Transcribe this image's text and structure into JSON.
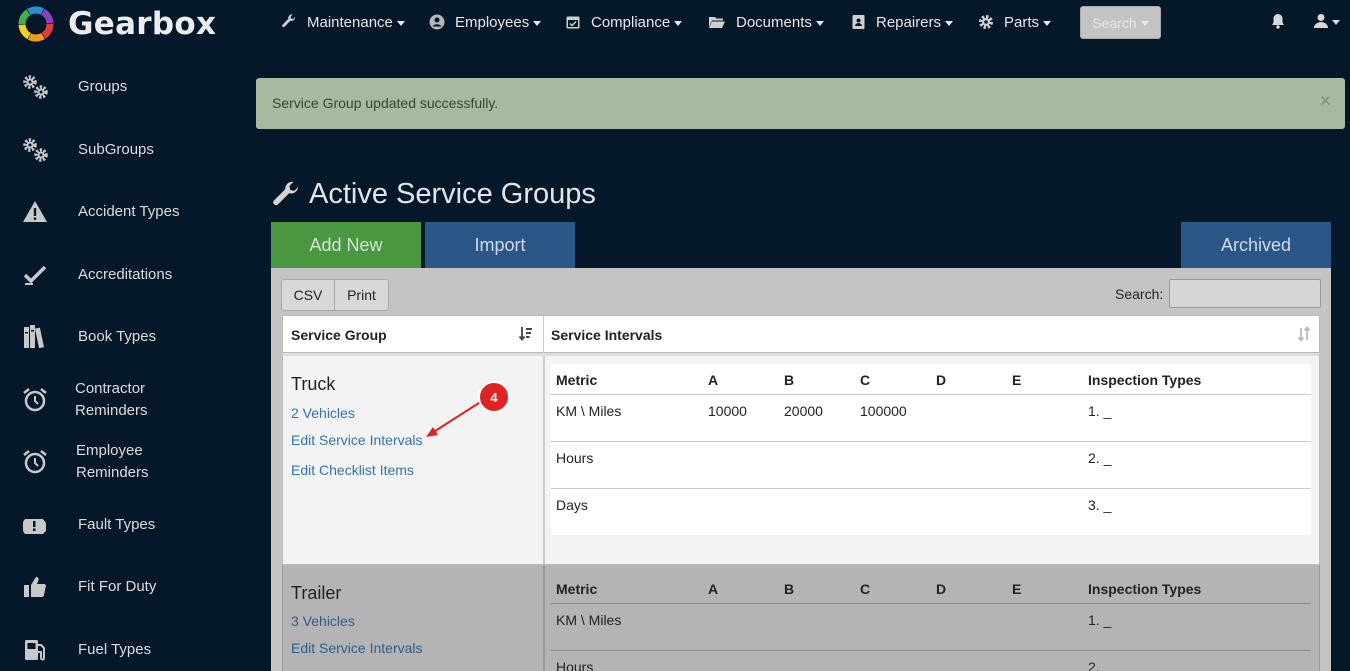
{
  "app": {
    "name": "Gearbox"
  },
  "nav": {
    "items": [
      {
        "label": "Maintenance",
        "icon": "wrench-icon"
      },
      {
        "label": "Employees",
        "icon": "user-circle-icon"
      },
      {
        "label": "Compliance",
        "icon": "calendar-check-icon"
      },
      {
        "label": "Documents",
        "icon": "folder-open-icon"
      },
      {
        "label": "Repairers",
        "icon": "address-book-icon"
      },
      {
        "label": "Parts",
        "icon": "gear-icon"
      }
    ],
    "search_label": "Search"
  },
  "sidebar": {
    "items": [
      {
        "label": "Groups",
        "icon": "gears-icon"
      },
      {
        "label": "SubGroups",
        "icon": "gears-icon"
      },
      {
        "label": "Accident Types",
        "icon": "warning-icon"
      },
      {
        "label": "Accreditations",
        "icon": "check-icon"
      },
      {
        "label": "Book Types",
        "icon": "books-icon"
      },
      {
        "label": "Contractor Reminders",
        "icon": "alarm-clock-icon"
      },
      {
        "label": "Employee Reminders",
        "icon": "alarm-clock-icon"
      },
      {
        "label": "Fault Types",
        "icon": "engine-warning-icon"
      },
      {
        "label": "Fit For Duty",
        "icon": "thumbs-up-icon"
      },
      {
        "label": "Fuel Types",
        "icon": "fuel-pump-icon"
      }
    ]
  },
  "alert": {
    "message": "Service Group updated successfully.",
    "close": "×"
  },
  "page": {
    "title": "Active Service Groups",
    "add_label": "Add New",
    "import_label": "Import",
    "archived_label": "Archived"
  },
  "table": {
    "csv_label": "CSV",
    "print_label": "Print",
    "search_label": "Search:",
    "headers": {
      "group": "Service Group",
      "intervals": "Service Intervals"
    },
    "inner_headers": [
      "Metric",
      "A",
      "B",
      "C",
      "D",
      "E",
      "Inspection Types"
    ],
    "groups": [
      {
        "name": "Truck",
        "vehicles": "2 Vehicles",
        "edit_intervals": "Edit Service Intervals",
        "edit_checklist": "Edit Checklist Items",
        "rows": [
          {
            "metric": "KM \\ Miles",
            "a": "10000",
            "b": "20000",
            "c": "100000",
            "d": "",
            "e": "",
            "inspection": "1. _"
          },
          {
            "metric": "Hours",
            "a": "",
            "b": "",
            "c": "",
            "d": "",
            "e": "",
            "inspection": "2. _"
          },
          {
            "metric": "Days",
            "a": "",
            "b": "",
            "c": "",
            "d": "",
            "e": "",
            "inspection": "3. _"
          }
        ]
      },
      {
        "name": "Trailer",
        "vehicles": "3 Vehicles",
        "edit_intervals": "Edit Service Intervals",
        "rows": [
          {
            "metric": "KM \\ Miles",
            "inspection": "1. _"
          },
          {
            "metric": "Hours",
            "inspection": "2."
          }
        ]
      }
    ]
  },
  "annotation": {
    "step": "4",
    "color": "#e02424"
  }
}
